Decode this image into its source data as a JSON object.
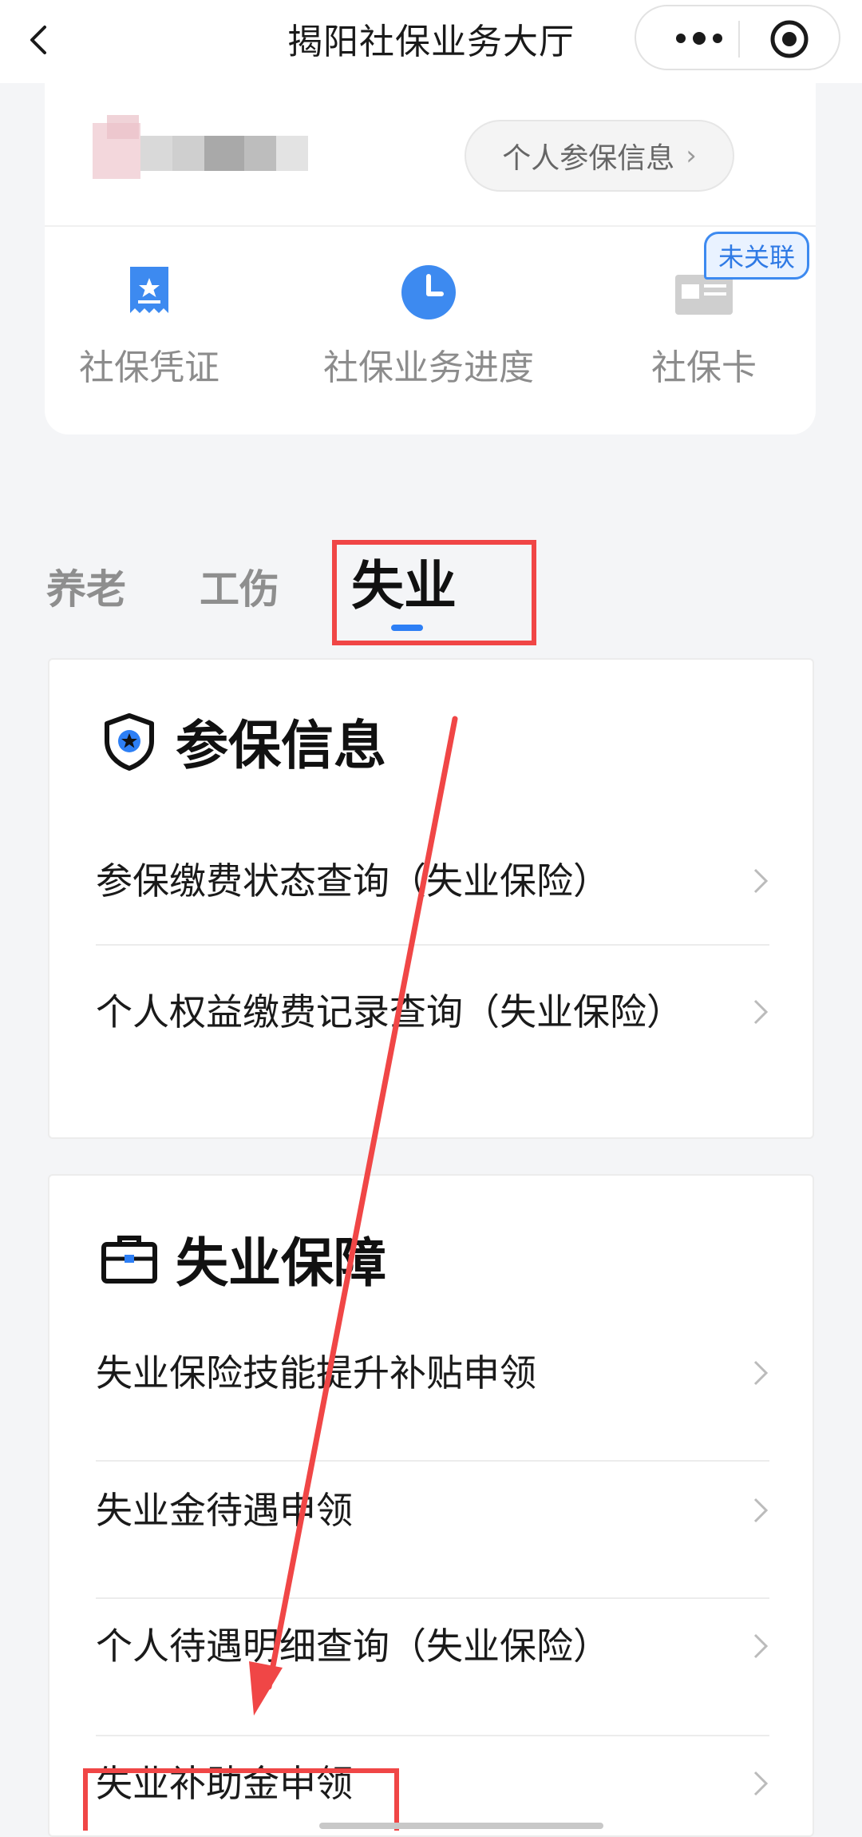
{
  "nav": {
    "title": "揭阳社保业务大厅"
  },
  "profile": {
    "info_button": "个人参保信息",
    "quick_actions": [
      {
        "label": "社保凭证",
        "icon": "certificate-icon"
      },
      {
        "label": "社保业务进度",
        "icon": "clock-icon"
      },
      {
        "label": "社保卡",
        "icon": "social-security-card-icon"
      }
    ],
    "card_badge": "未关联"
  },
  "tabs": [
    {
      "label": "养老",
      "active": false
    },
    {
      "label": "工伤",
      "active": false
    },
    {
      "label": "失业",
      "active": true
    }
  ],
  "sections": [
    {
      "title": "参保信息",
      "icon": "shield-star-icon",
      "rows": [
        {
          "label": "参保缴费状态查询（失业保险）"
        },
        {
          "label": "个人权益缴费记录查询（失业保险）"
        }
      ]
    },
    {
      "title": "失业保障",
      "icon": "briefcase-icon",
      "rows": [
        {
          "label": "失业保险技能提升补贴申领"
        },
        {
          "label": "失业金待遇申领"
        },
        {
          "label": "个人待遇明细查询（失业保险）"
        },
        {
          "label": "失业补助金申领"
        }
      ]
    }
  ],
  "colors": {
    "accent": "#2d7ff5",
    "annotation_red": "#f04646",
    "page_bg": "#f4f5f7"
  }
}
